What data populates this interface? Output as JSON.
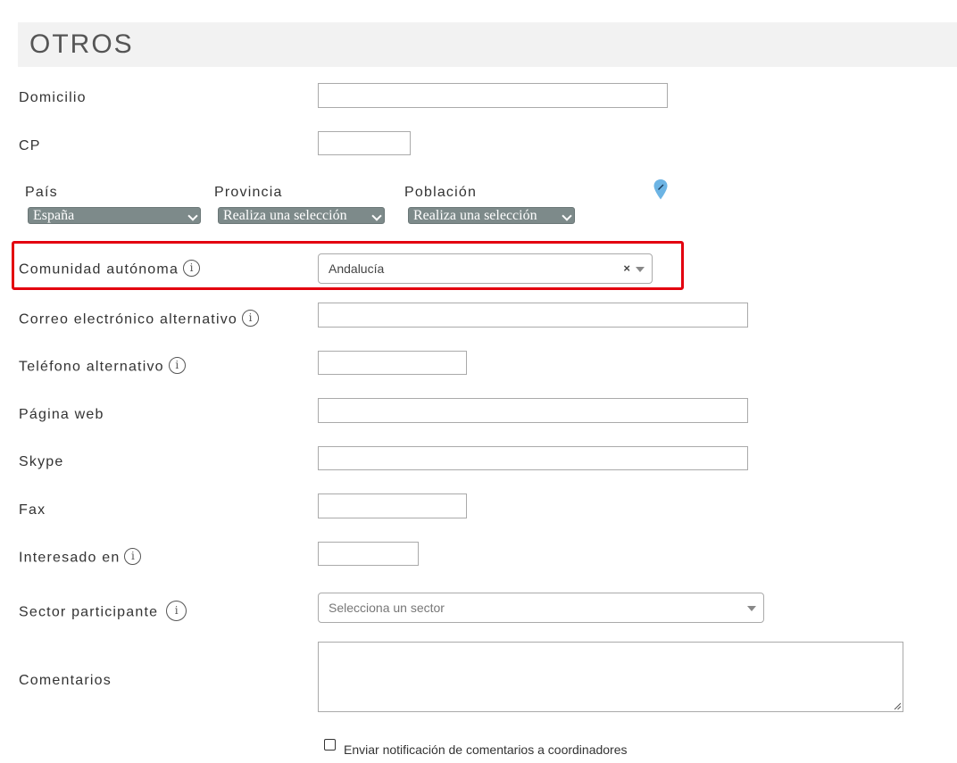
{
  "section": {
    "title": "OTROS"
  },
  "fields": {
    "domicilio": {
      "label": "Domicilio",
      "value": ""
    },
    "cp": {
      "label": "CP",
      "value": ""
    },
    "pais": {
      "label": "País",
      "selected": "España"
    },
    "provincia": {
      "label": "Provincia",
      "selected": "Realiza una selección"
    },
    "poblacion": {
      "label": "Población",
      "selected": "Realiza una selección"
    },
    "comunidad": {
      "label": "Comunidad autónoma",
      "selected": "Andalucía",
      "clear": "×"
    },
    "correo_alt": {
      "label": "Correo electrónico alternativo",
      "value": ""
    },
    "telefono_alt": {
      "label": "Teléfono alternativo",
      "value": ""
    },
    "pagina_web": {
      "label": "Página web",
      "value": ""
    },
    "skype": {
      "label": "Skype",
      "value": ""
    },
    "fax": {
      "label": "Fax",
      "value": ""
    },
    "interesado": {
      "label": "Interesado en",
      "value": ""
    },
    "sector": {
      "label": "Sector participante",
      "placeholder": "Selecciona un sector"
    },
    "comentarios": {
      "label": "Comentarios",
      "value": ""
    }
  },
  "notify": {
    "label": "Enviar notificación de comentarios a coordinadores",
    "checked": false
  },
  "icons": {
    "info": "i",
    "info_icon": "info-circle-icon",
    "map_icon": "map-pin-icon"
  },
  "colors": {
    "highlight": "#e3000f",
    "location_select": "#7d8a8a",
    "map_pin": "#6cb4e4"
  }
}
